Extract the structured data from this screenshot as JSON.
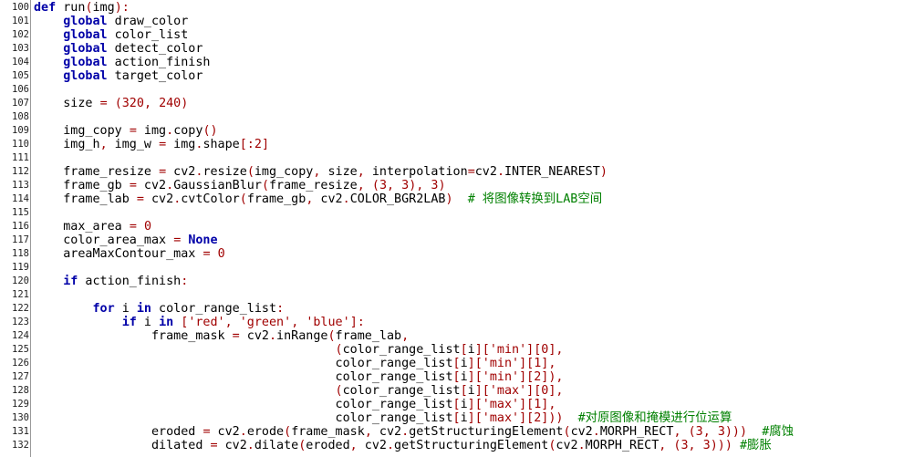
{
  "editor": {
    "lines": [
      {
        "n": "100",
        "segs": [
          [
            "kw",
            "def"
          ],
          [
            "txt",
            " run"
          ],
          [
            "punc",
            "("
          ],
          [
            "txt",
            "img"
          ],
          [
            "punc",
            "):"
          ]
        ]
      },
      {
        "n": "101",
        "segs": [
          [
            "txt",
            "    "
          ],
          [
            "kw",
            "global"
          ],
          [
            "txt",
            " draw_color"
          ]
        ]
      },
      {
        "n": "102",
        "segs": [
          [
            "txt",
            "    "
          ],
          [
            "kw",
            "global"
          ],
          [
            "txt",
            " color_list"
          ]
        ]
      },
      {
        "n": "103",
        "segs": [
          [
            "txt",
            "    "
          ],
          [
            "kw",
            "global"
          ],
          [
            "txt",
            " detect_color"
          ]
        ]
      },
      {
        "n": "104",
        "segs": [
          [
            "txt",
            "    "
          ],
          [
            "kw",
            "global"
          ],
          [
            "txt",
            " action_finish"
          ]
        ]
      },
      {
        "n": "105",
        "segs": [
          [
            "txt",
            "    "
          ],
          [
            "kw",
            "global"
          ],
          [
            "txt",
            " target_color"
          ]
        ]
      },
      {
        "n": "106",
        "segs": []
      },
      {
        "n": "107",
        "segs": [
          [
            "txt",
            "    size "
          ],
          [
            "punc",
            "="
          ],
          [
            "txt",
            " "
          ],
          [
            "punc",
            "("
          ],
          [
            "num",
            "320"
          ],
          [
            "punc",
            ","
          ],
          [
            "txt",
            " "
          ],
          [
            "num",
            "240"
          ],
          [
            "punc",
            ")"
          ]
        ]
      },
      {
        "n": "108",
        "segs": []
      },
      {
        "n": "109",
        "segs": [
          [
            "txt",
            "    img_copy "
          ],
          [
            "punc",
            "="
          ],
          [
            "txt",
            " img"
          ],
          [
            "punc",
            "."
          ],
          [
            "txt",
            "copy"
          ],
          [
            "punc",
            "()"
          ]
        ]
      },
      {
        "n": "110",
        "segs": [
          [
            "txt",
            "    img_h"
          ],
          [
            "punc",
            ","
          ],
          [
            "txt",
            " img_w "
          ],
          [
            "punc",
            "="
          ],
          [
            "txt",
            " img"
          ],
          [
            "punc",
            "."
          ],
          [
            "txt",
            "shape"
          ],
          [
            "punc",
            "[:"
          ],
          [
            "num",
            "2"
          ],
          [
            "punc",
            "]"
          ]
        ]
      },
      {
        "n": "111",
        "segs": []
      },
      {
        "n": "112",
        "segs": [
          [
            "txt",
            "    frame_resize "
          ],
          [
            "punc",
            "="
          ],
          [
            "txt",
            " cv2"
          ],
          [
            "punc",
            "."
          ],
          [
            "txt",
            "resize"
          ],
          [
            "punc",
            "("
          ],
          [
            "txt",
            "img_copy"
          ],
          [
            "punc",
            ","
          ],
          [
            "txt",
            " size"
          ],
          [
            "punc",
            ","
          ],
          [
            "txt",
            " interpolation"
          ],
          [
            "punc",
            "="
          ],
          [
            "txt",
            "cv2"
          ],
          [
            "punc",
            "."
          ],
          [
            "txt",
            "INTER_NEAREST"
          ],
          [
            "punc",
            ")"
          ]
        ]
      },
      {
        "n": "113",
        "segs": [
          [
            "txt",
            "    frame_gb "
          ],
          [
            "punc",
            "="
          ],
          [
            "txt",
            " cv2"
          ],
          [
            "punc",
            "."
          ],
          [
            "txt",
            "GaussianBlur"
          ],
          [
            "punc",
            "("
          ],
          [
            "txt",
            "frame_resize"
          ],
          [
            "punc",
            ","
          ],
          [
            "txt",
            " "
          ],
          [
            "punc",
            "("
          ],
          [
            "num",
            "3"
          ],
          [
            "punc",
            ","
          ],
          [
            "txt",
            " "
          ],
          [
            "num",
            "3"
          ],
          [
            "punc",
            "),"
          ],
          [
            "txt",
            " "
          ],
          [
            "num",
            "3"
          ],
          [
            "punc",
            ")"
          ]
        ]
      },
      {
        "n": "114",
        "segs": [
          [
            "txt",
            "    frame_lab "
          ],
          [
            "punc",
            "="
          ],
          [
            "txt",
            " cv2"
          ],
          [
            "punc",
            "."
          ],
          [
            "txt",
            "cvtColor"
          ],
          [
            "punc",
            "("
          ],
          [
            "txt",
            "frame_gb"
          ],
          [
            "punc",
            ","
          ],
          [
            "txt",
            " cv2"
          ],
          [
            "punc",
            "."
          ],
          [
            "txt",
            "COLOR_BGR2LAB"
          ],
          [
            "punc",
            ")"
          ],
          [
            "txt",
            "  "
          ],
          [
            "cmt",
            "# 将图像转换到LAB空间"
          ]
        ]
      },
      {
        "n": "115",
        "segs": []
      },
      {
        "n": "116",
        "segs": [
          [
            "txt",
            "    max_area "
          ],
          [
            "punc",
            "="
          ],
          [
            "txt",
            " "
          ],
          [
            "num",
            "0"
          ]
        ]
      },
      {
        "n": "117",
        "segs": [
          [
            "txt",
            "    color_area_max "
          ],
          [
            "punc",
            "="
          ],
          [
            "txt",
            " "
          ],
          [
            "kw",
            "None"
          ]
        ]
      },
      {
        "n": "118",
        "segs": [
          [
            "txt",
            "    areaMaxContour_max "
          ],
          [
            "punc",
            "="
          ],
          [
            "txt",
            " "
          ],
          [
            "num",
            "0"
          ]
        ]
      },
      {
        "n": "119",
        "segs": []
      },
      {
        "n": "120",
        "segs": [
          [
            "txt",
            "    "
          ],
          [
            "kw",
            "if"
          ],
          [
            "txt",
            " action_finish"
          ],
          [
            "punc",
            ":"
          ]
        ]
      },
      {
        "n": "121",
        "segs": []
      },
      {
        "n": "122",
        "segs": [
          [
            "txt",
            "        "
          ],
          [
            "kw",
            "for"
          ],
          [
            "txt",
            " i "
          ],
          [
            "kw",
            "in"
          ],
          [
            "txt",
            " color_range_list"
          ],
          [
            "punc",
            ":"
          ]
        ]
      },
      {
        "n": "123",
        "segs": [
          [
            "txt",
            "            "
          ],
          [
            "kw",
            "if"
          ],
          [
            "txt",
            " i "
          ],
          [
            "kw",
            "in"
          ],
          [
            "txt",
            " "
          ],
          [
            "punc",
            "["
          ],
          [
            "str",
            "'red'"
          ],
          [
            "punc",
            ","
          ],
          [
            "txt",
            " "
          ],
          [
            "str",
            "'green'"
          ],
          [
            "punc",
            ","
          ],
          [
            "txt",
            " "
          ],
          [
            "str",
            "'blue'"
          ],
          [
            "punc",
            "]:"
          ]
        ]
      },
      {
        "n": "124",
        "segs": [
          [
            "txt",
            "                frame_mask "
          ],
          [
            "punc",
            "="
          ],
          [
            "txt",
            " cv2"
          ],
          [
            "punc",
            "."
          ],
          [
            "txt",
            "inRange"
          ],
          [
            "punc",
            "("
          ],
          [
            "txt",
            "frame_lab"
          ],
          [
            "punc",
            ","
          ]
        ]
      },
      {
        "n": "125",
        "segs": [
          [
            "txt",
            "                                         "
          ],
          [
            "punc",
            "("
          ],
          [
            "txt",
            "color_range_list"
          ],
          [
            "punc",
            "["
          ],
          [
            "txt",
            "i"
          ],
          [
            "punc",
            "]["
          ],
          [
            "str",
            "'min'"
          ],
          [
            "punc",
            "]["
          ],
          [
            "num",
            "0"
          ],
          [
            "punc",
            "],"
          ]
        ]
      },
      {
        "n": "126",
        "segs": [
          [
            "txt",
            "                                         color_range_list"
          ],
          [
            "punc",
            "["
          ],
          [
            "txt",
            "i"
          ],
          [
            "punc",
            "]["
          ],
          [
            "str",
            "'min'"
          ],
          [
            "punc",
            "]["
          ],
          [
            "num",
            "1"
          ],
          [
            "punc",
            "],"
          ]
        ]
      },
      {
        "n": "127",
        "segs": [
          [
            "txt",
            "                                         color_range_list"
          ],
          [
            "punc",
            "["
          ],
          [
            "txt",
            "i"
          ],
          [
            "punc",
            "]["
          ],
          [
            "str",
            "'min'"
          ],
          [
            "punc",
            "]["
          ],
          [
            "num",
            "2"
          ],
          [
            "punc",
            "]),"
          ]
        ]
      },
      {
        "n": "128",
        "segs": [
          [
            "txt",
            "                                         "
          ],
          [
            "punc",
            "("
          ],
          [
            "txt",
            "color_range_list"
          ],
          [
            "punc",
            "["
          ],
          [
            "txt",
            "i"
          ],
          [
            "punc",
            "]["
          ],
          [
            "str",
            "'max'"
          ],
          [
            "punc",
            "]["
          ],
          [
            "num",
            "0"
          ],
          [
            "punc",
            "],"
          ]
        ]
      },
      {
        "n": "129",
        "segs": [
          [
            "txt",
            "                                         color_range_list"
          ],
          [
            "punc",
            "["
          ],
          [
            "txt",
            "i"
          ],
          [
            "punc",
            "]["
          ],
          [
            "str",
            "'max'"
          ],
          [
            "punc",
            "]["
          ],
          [
            "num",
            "1"
          ],
          [
            "punc",
            "],"
          ]
        ]
      },
      {
        "n": "130",
        "segs": [
          [
            "txt",
            "                                         color_range_list"
          ],
          [
            "punc",
            "["
          ],
          [
            "txt",
            "i"
          ],
          [
            "punc",
            "]["
          ],
          [
            "str",
            "'max'"
          ],
          [
            "punc",
            "]["
          ],
          [
            "num",
            "2"
          ],
          [
            "punc",
            "]))"
          ],
          [
            "txt",
            "  "
          ],
          [
            "cmt",
            "#对原图像和掩模进行位运算"
          ]
        ]
      },
      {
        "n": "131",
        "segs": [
          [
            "txt",
            "                eroded "
          ],
          [
            "punc",
            "="
          ],
          [
            "txt",
            " cv2"
          ],
          [
            "punc",
            "."
          ],
          [
            "txt",
            "erode"
          ],
          [
            "punc",
            "("
          ],
          [
            "txt",
            "frame_mask"
          ],
          [
            "punc",
            ","
          ],
          [
            "txt",
            " cv2"
          ],
          [
            "punc",
            "."
          ],
          [
            "txt",
            "getStructuringElement"
          ],
          [
            "punc",
            "("
          ],
          [
            "txt",
            "cv2"
          ],
          [
            "punc",
            "."
          ],
          [
            "txt",
            "MORPH_RECT"
          ],
          [
            "punc",
            ","
          ],
          [
            "txt",
            " "
          ],
          [
            "punc",
            "("
          ],
          [
            "num",
            "3"
          ],
          [
            "punc",
            ","
          ],
          [
            "txt",
            " "
          ],
          [
            "num",
            "3"
          ],
          [
            "punc",
            ")))"
          ],
          [
            "txt",
            "  "
          ],
          [
            "cmt",
            "#腐蚀"
          ]
        ]
      },
      {
        "n": "132",
        "segs": [
          [
            "txt",
            "                dilated "
          ],
          [
            "punc",
            "="
          ],
          [
            "txt",
            " cv2"
          ],
          [
            "punc",
            "."
          ],
          [
            "txt",
            "dilate"
          ],
          [
            "punc",
            "("
          ],
          [
            "txt",
            "eroded"
          ],
          [
            "punc",
            ","
          ],
          [
            "txt",
            " cv2"
          ],
          [
            "punc",
            "."
          ],
          [
            "txt",
            "getStructuringElement"
          ],
          [
            "punc",
            "("
          ],
          [
            "txt",
            "cv2"
          ],
          [
            "punc",
            "."
          ],
          [
            "txt",
            "MORPH_RECT"
          ],
          [
            "punc",
            ","
          ],
          [
            "txt",
            " "
          ],
          [
            "punc",
            "("
          ],
          [
            "num",
            "3"
          ],
          [
            "punc",
            ","
          ],
          [
            "txt",
            " "
          ],
          [
            "num",
            "3"
          ],
          [
            "punc",
            ")))"
          ],
          [
            "txt",
            " "
          ],
          [
            "cmt",
            "#膨胀"
          ]
        ]
      }
    ]
  }
}
